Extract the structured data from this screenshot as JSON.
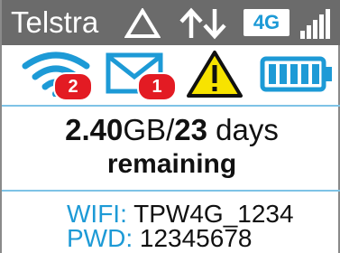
{
  "status_bar": {
    "carrier": "Telstra",
    "network_type": "4G",
    "signal_icon": "signal-bars-icon",
    "roaming_icon": "triangle-icon",
    "data_transfer_icon": "up-down-arrows-icon"
  },
  "notifications": {
    "wifi": {
      "icon": "wifi-icon",
      "count": "2"
    },
    "messages": {
      "icon": "mail-icon",
      "count": "1"
    },
    "alert": {
      "icon": "warning-icon",
      "symbol": "!"
    },
    "battery": {
      "icon": "battery-icon",
      "level": 1.0
    }
  },
  "usage": {
    "amount": "2.40",
    "amount_unit": "GB/",
    "days": "23",
    "days_unit": " days",
    "remaining_label": "remaining"
  },
  "credentials": {
    "wifi_label": "WIFI:",
    "wifi_value": "TPW4G_1234",
    "pwd_label": "PWD:",
    "pwd_value": "12345678"
  },
  "colors": {
    "status_bar_bg": "#6b6b6b",
    "accent": "#1d9ad6",
    "badge_red": "#e31b23",
    "warning_yellow": "#f7e300"
  }
}
